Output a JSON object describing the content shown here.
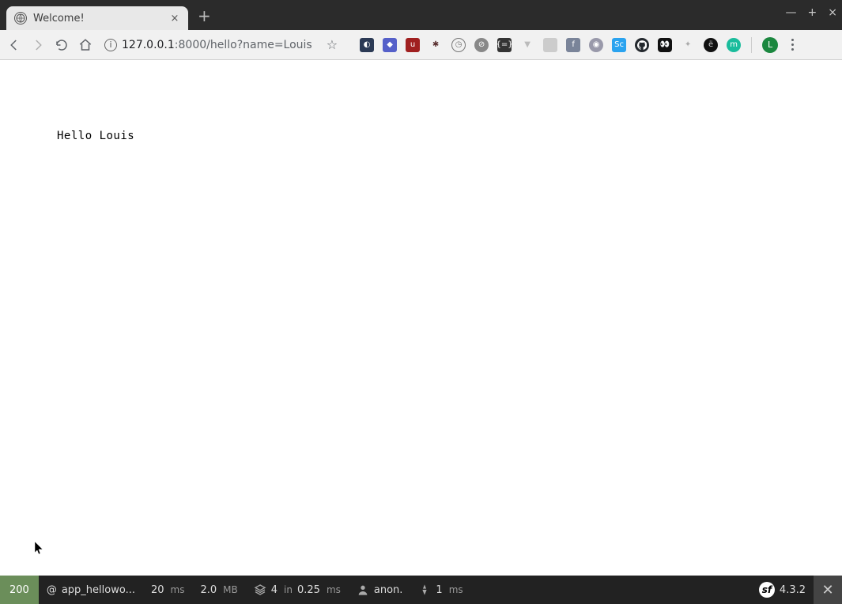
{
  "window": {
    "tab_title": "Welcome!",
    "minimize": "—",
    "maximize": "+",
    "close": "×"
  },
  "toolbar": {
    "url_host": "127.0.0.1",
    "url_port_path": ":8000/hello?name=Louis",
    "avatar_letter": "L"
  },
  "page": {
    "greeting": "Hello Louis"
  },
  "sf_toolbar": {
    "status": "200",
    "route_prefix": "@",
    "route": "app_hellowo...",
    "time_value": "20",
    "time_unit": "ms",
    "memory_value": "2.0",
    "memory_unit": "MB",
    "twig_count": "4",
    "twig_in": "in",
    "twig_time": "0.25",
    "twig_unit": "ms",
    "user": "anon.",
    "db_count": "1",
    "db_unit": "ms",
    "version": "4.3.2",
    "close": "✕"
  }
}
